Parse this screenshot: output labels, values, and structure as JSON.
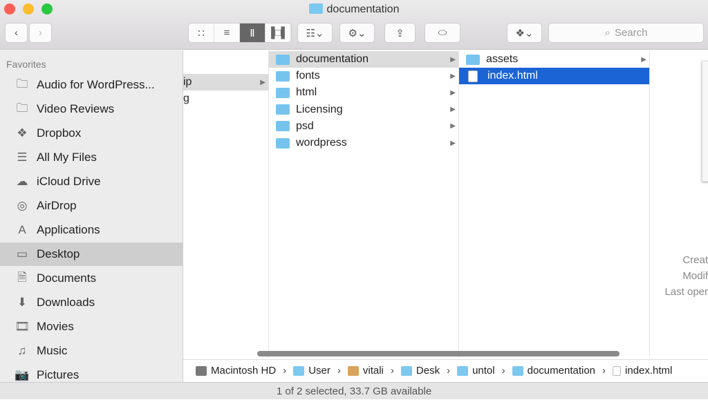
{
  "window": {
    "title": "documentation"
  },
  "toolbar": {
    "search_placeholder": "Search",
    "view_modes": [
      "icon",
      "list",
      "column",
      "cover-flow"
    ],
    "active_view": "column"
  },
  "sidebar": {
    "heading": "Favorites",
    "items": [
      {
        "label": "Audio for WordPress...",
        "icon": "folder-icon"
      },
      {
        "label": "Video Reviews",
        "icon": "folder-icon"
      },
      {
        "label": "Dropbox",
        "icon": "dropbox-icon"
      },
      {
        "label": "All My Files",
        "icon": "all-files-icon"
      },
      {
        "label": "iCloud Drive",
        "icon": "cloud-icon"
      },
      {
        "label": "AirDrop",
        "icon": "airdrop-icon"
      },
      {
        "label": "Applications",
        "icon": "applications-icon"
      },
      {
        "label": "Desktop",
        "icon": "desktop-icon",
        "selected": true
      },
      {
        "label": "Documents",
        "icon": "documents-icon"
      },
      {
        "label": "Downloads",
        "icon": "downloads-icon"
      },
      {
        "label": "Movies",
        "icon": "movies-icon"
      },
      {
        "label": "Music",
        "icon": "music-icon"
      },
      {
        "label": "Pictures",
        "icon": "pictures-icon"
      }
    ]
  },
  "columns": {
    "col1": [
      "",
      "ip",
      "g"
    ],
    "col2": [
      "documentation",
      "fonts",
      "html",
      "Licensing",
      "psd",
      "wordpress"
    ],
    "col3": [
      "assets",
      "index.html"
    ]
  },
  "preview": {
    "created": "Creat",
    "modified": "Modif",
    "last_opened": "Last oper"
  },
  "pathbar": [
    "Macintosh HD",
    "User",
    "vitali",
    "Desk",
    "untol",
    "documentation",
    "index.html"
  ],
  "status": "1 of 2 selected, 33.7 GB available"
}
